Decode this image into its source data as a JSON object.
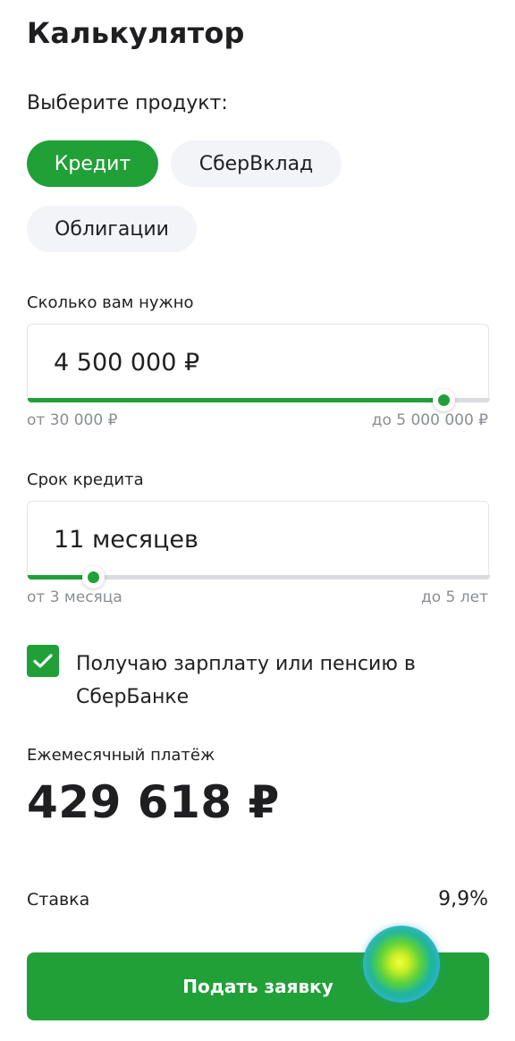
{
  "header": {
    "title": "Калькулятор"
  },
  "product": {
    "label": "Выберите продукт:",
    "options": [
      {
        "label": "Кредит",
        "selected": true
      },
      {
        "label": "СберВклад",
        "selected": false
      },
      {
        "label": "Облигации",
        "selected": false
      }
    ]
  },
  "amount": {
    "label": "Сколько вам нужно",
    "value": "4 500 000 ₽",
    "min_label": "от 30 000 ₽",
    "max_label": "до 5 000 000 ₽",
    "min": 30000,
    "max": 5000000,
    "current": 4500000
  },
  "term": {
    "label": "Срок кредита",
    "value": "11 месяцев",
    "min_label": "от 3 месяца",
    "max_label": "до 5 лет",
    "min_months": 3,
    "max_months": 60,
    "current_months": 11
  },
  "salary_checkbox": {
    "label": "Получаю зарплату или пенсию в СберБанке",
    "checked": true
  },
  "payment": {
    "label": "Ежемесячный платёж",
    "value": "429 618 ₽"
  },
  "rate": {
    "label": "Ставка",
    "value": "9,9%"
  },
  "submit": {
    "label": "Подать заявку"
  },
  "icons": {
    "checkbox": "check-icon",
    "assistant": "assistant-orb-icon"
  },
  "colors": {
    "accent": "#21a038",
    "chip_inactive": "#f2f4f7",
    "text": "#1f1f22",
    "muted": "#8a8d93"
  }
}
